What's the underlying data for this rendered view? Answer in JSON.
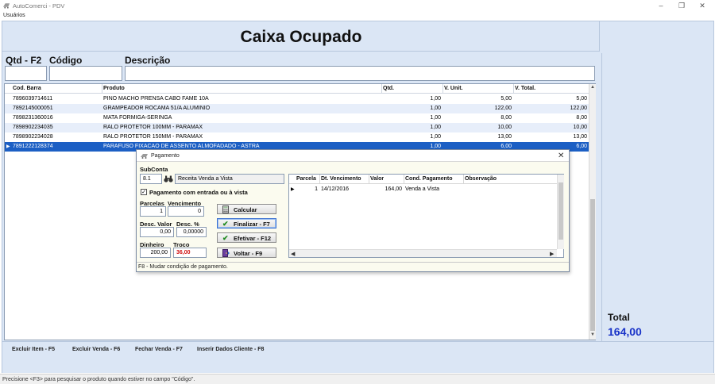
{
  "window": {
    "title": "AutoComerci - PDV",
    "minimize_glyph": "–",
    "restore_glyph": "❐",
    "close_glyph": "✕"
  },
  "menu": {
    "items": [
      {
        "label": "Usuários"
      }
    ]
  },
  "header": {
    "title": "Caixa Ocupado"
  },
  "entry": {
    "qtd_label": "Qtd - F2",
    "codigo_label": "Código",
    "descricao_label": "Descrição",
    "qtd_value": "",
    "codigo_value": "",
    "descricao_value": ""
  },
  "items_table": {
    "columns": [
      "Cod. Barra",
      "Produto",
      "Qtd.",
      "V. Unit.",
      "V. Total."
    ],
    "rows": [
      {
        "cod": "7896039714611",
        "produto": "PINO MACHO PRENSA CABO FAME 10A",
        "qtd": "1,00",
        "unit": "5,00",
        "total": "5,00"
      },
      {
        "cod": "7892145000051",
        "produto": "GRAMPEADOR ROCAMA 51/A ALUMINIO",
        "qtd": "1,00",
        "unit": "122,00",
        "total": "122,00"
      },
      {
        "cod": "7898231360016",
        "produto": "MATA FORMIGA-SERINGA",
        "qtd": "1,00",
        "unit": "8,00",
        "total": "8,00"
      },
      {
        "cod": "7898902234035",
        "produto": "RALO PROTETOR 100MM - PARAMAX",
        "qtd": "1,00",
        "unit": "10,00",
        "total": "10,00"
      },
      {
        "cod": "7898902234028",
        "produto": "RALO PROTETOR 150MM - PARAMAX",
        "qtd": "1,00",
        "unit": "13,00",
        "total": "13,00"
      },
      {
        "cod": "7891222128374",
        "produto": "PARAFUSO FIXACAO DE ASSENTO ALMOFADADO - ASTRA",
        "qtd": "1,00",
        "unit": "6,00",
        "total": "6,00"
      }
    ],
    "selected_row_index": 5,
    "row_indicator": "▶"
  },
  "totals": {
    "label": "Total",
    "value": "164,00"
  },
  "footer": {
    "keys": [
      {
        "label": "Excluir Item - F5"
      },
      {
        "label": "Excluir Venda - F6"
      },
      {
        "label": "Fechar Venda - F7"
      },
      {
        "label": "Inserir Dados Cliente - F8"
      }
    ]
  },
  "status": {
    "text": "Precisione <F3> para pesquisar o produto quando estiver no campo \"Código\"."
  },
  "payment_dialog": {
    "title": "Pagamento",
    "close_glyph": "✕",
    "subconta_label": "SubConta",
    "subconta_code": "8.1",
    "subconta_name": "Receita Venda a Vista",
    "lookup_icon": "binoculars-icon",
    "entrada_checkbox": {
      "label": "Pagamento com entrada ou à vista",
      "checked": true,
      "glyph": "✓"
    },
    "parcelas_label": "Parcelas",
    "parcelas_value": "1",
    "vencimento_label": "Vencimento",
    "vencimento_value": "0",
    "desc_valor_label": "Desc. Valor",
    "desc_valor_value": "0,00",
    "desc_pct_label": "Desc. %",
    "desc_pct_value": "0,00000",
    "dinheiro_label": "Dinheiro",
    "dinheiro_value": "200,00",
    "troco_label": "Troco",
    "troco_value": "36,00",
    "troco_color": "#d01010",
    "buttons": {
      "calcular": {
        "label": "Calcular",
        "icon": "calculator-icon",
        "glyph": "🖩"
      },
      "finalizar": {
        "label": "Finalizar - F7",
        "icon": "checkmark-icon",
        "glyph": "✔"
      },
      "efetivar": {
        "label": "Efetivar - F12",
        "icon": "checkmark-icon",
        "glyph": "✔"
      },
      "voltar": {
        "label": "Voltar - F9",
        "icon": "door-exit-icon",
        "glyph": "▮"
      }
    },
    "installments": {
      "columns": [
        "Parcela",
        "Dt. Vencimento",
        "Valor",
        "Cond. Pagamento",
        "Observação"
      ],
      "rows": [
        {
          "parcela": "1",
          "vencimento": "14/12/2016",
          "valor": "164,00",
          "condicao": "Venda a Vista",
          "obs": ""
        }
      ],
      "row_indicator": "▶",
      "scroll_left_glyph": "◀",
      "scroll_right_glyph": "▶"
    },
    "status_text": "F8 - Mudar condição de pagamento."
  },
  "colors": {
    "panel_bg": "#dbe6f5",
    "selection": "#1c5fc4",
    "row_alt": "#e7eefa",
    "total_value": "#1a34c8",
    "dialog_bg": "#fbfbef"
  }
}
